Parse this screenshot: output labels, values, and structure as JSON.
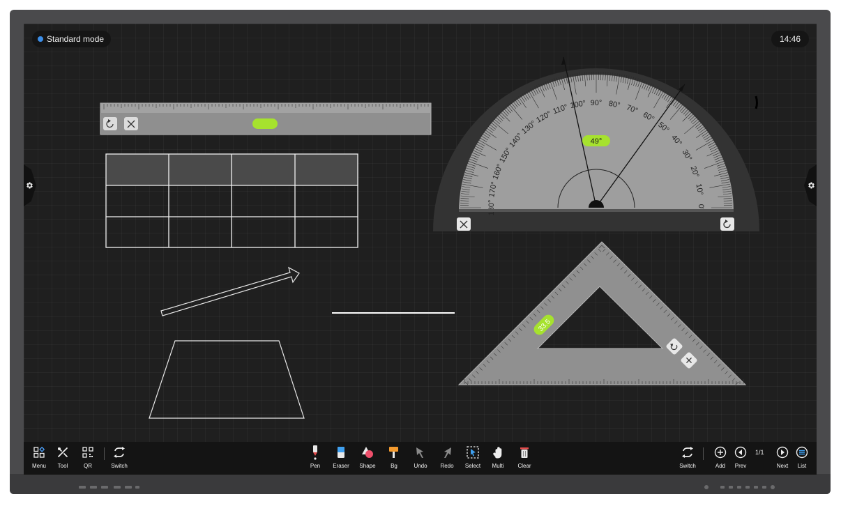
{
  "status": {
    "mode": "Standard mode",
    "time": "14:46"
  },
  "side_icons": {
    "left": "gear-icon",
    "right": "gear-icon"
  },
  "ruler": {
    "badge_color": "#a6e22e"
  },
  "protractor": {
    "angle_label": "49°",
    "degree_labels": [
      "180°",
      "170°",
      "160°",
      "150°",
      "140°",
      "130°",
      "120°",
      "110°",
      "100°",
      "90°",
      "80°",
      "70°",
      "60°",
      "50°",
      "40°",
      "30°",
      "20°",
      "10°",
      "0°"
    ]
  },
  "set_square": {
    "measure_label": "33.5"
  },
  "toolbar": {
    "left": [
      {
        "id": "menu",
        "label": "Menu",
        "icon": "menu-icon"
      },
      {
        "id": "tool",
        "label": "Tool",
        "icon": "tool-icon"
      },
      {
        "id": "qr",
        "label": "QR",
        "icon": "qr-icon"
      },
      {
        "id": "switch",
        "label": "Switch",
        "icon": "switch-icon"
      }
    ],
    "center": [
      {
        "id": "pen",
        "label": "Pen",
        "icon": "pen-icon"
      },
      {
        "id": "eraser",
        "label": "Eraser",
        "icon": "eraser-icon"
      },
      {
        "id": "shape",
        "label": "Shape",
        "icon": "shape-icon"
      },
      {
        "id": "bg",
        "label": "Bg",
        "icon": "bg-icon"
      },
      {
        "id": "undo",
        "label": "Undo",
        "icon": "undo-icon"
      },
      {
        "id": "redo",
        "label": "Redo",
        "icon": "redo-icon"
      },
      {
        "id": "select",
        "label": "Select",
        "icon": "select-icon"
      },
      {
        "id": "multi",
        "label": "Multi",
        "icon": "multi-icon"
      },
      {
        "id": "clear",
        "label": "Clear",
        "icon": "clear-icon"
      }
    ],
    "right": [
      {
        "id": "switch2",
        "label": "Switch",
        "icon": "switch-icon"
      },
      {
        "id": "add",
        "label": "Add",
        "icon": "add-icon"
      },
      {
        "id": "prev",
        "label": "Prev",
        "icon": "prev-icon"
      },
      {
        "id": "next",
        "label": "Next",
        "icon": "next-icon"
      },
      {
        "id": "list",
        "label": "List",
        "icon": "list-icon"
      }
    ],
    "page_indicator": "1/1"
  },
  "colors": {
    "accent": "#a6e22e",
    "mode_dot": "#3c8ee8"
  }
}
